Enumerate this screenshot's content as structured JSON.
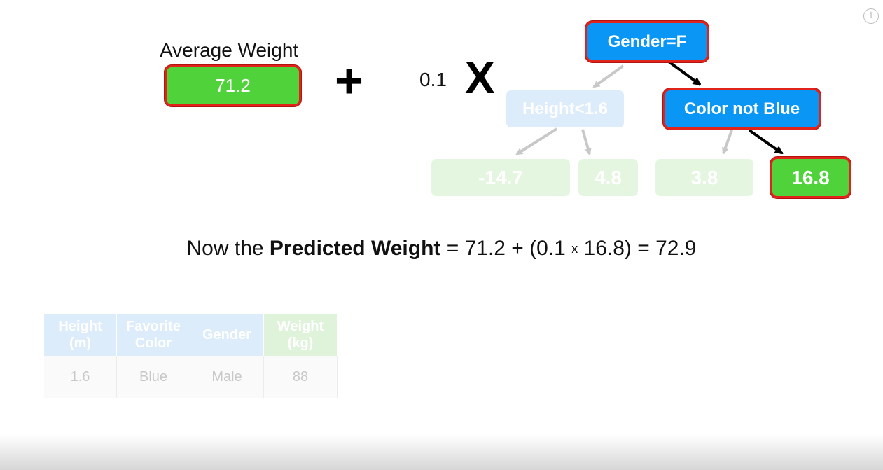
{
  "info_button": "i",
  "average": {
    "label": "Average Weight",
    "value": "71.2"
  },
  "operators": {
    "plus": "+",
    "times": "X"
  },
  "learning_rate": "0.1",
  "tree": {
    "root": "Gender=F",
    "left_node": "Height<1.6",
    "right_node": "Color not Blue",
    "leaves": [
      "-14.7",
      "4.8",
      "3.8",
      "16.8"
    ]
  },
  "sentence": {
    "prefix": "Now the ",
    "bold": "Predicted Weight",
    "part1": " = 71.2 + (0.1 ",
    "times_sign": "x",
    "part2": " 16.8) = 72.9"
  },
  "table": {
    "headers": [
      [
        "Height",
        "(m)"
      ],
      [
        "Favorite",
        "Color"
      ],
      [
        "Gender",
        ""
      ],
      [
        "Weight",
        "(kg)"
      ]
    ],
    "row": [
      "1.6",
      "Blue",
      "Male",
      "88"
    ]
  },
  "colors": {
    "highlight_green": "#4fd23a",
    "highlight_blue": "#0a96f5",
    "highlight_border": "#e0231b"
  }
}
